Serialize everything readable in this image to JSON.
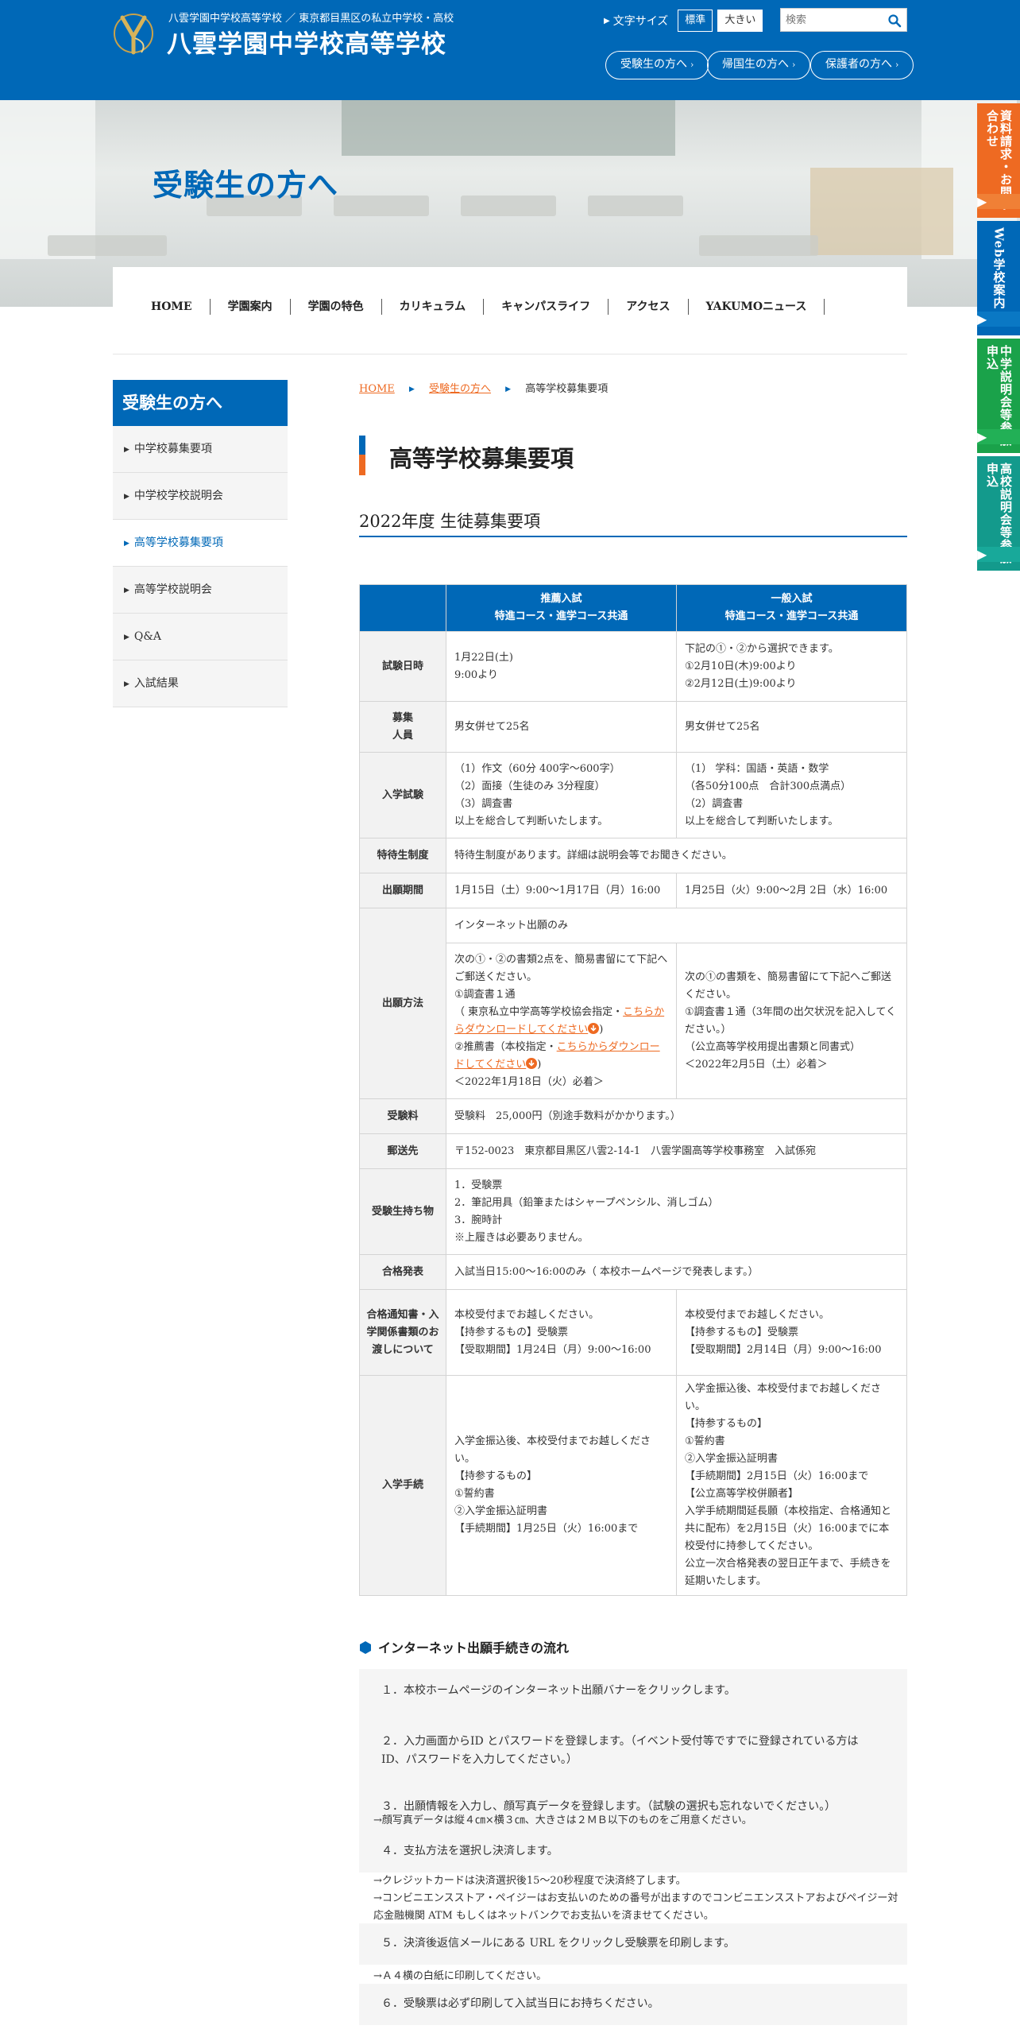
{
  "header": {
    "tagline": "八雲学園中学校高等学校 ／ 東京都目黒区の私立中学校・高校",
    "title": "八雲学園中学校高等学校",
    "font_size_label": "文字サイズ",
    "font_size_normal": "標準",
    "font_size_large": "大きい",
    "search_placeholder": "検索",
    "pills": [
      "受験生の方へ",
      "帰国生の方へ",
      "保護者の方へ"
    ],
    "pill_chev": "›"
  },
  "hero": {
    "title": "受験生の方へ"
  },
  "side_tabs": [
    {
      "label": "資料請求・お問い合わせ",
      "arrow": "▶"
    },
    {
      "label": "Web学校案内",
      "arrow": "▶"
    },
    {
      "label": "中学説明会等参加申込",
      "arrow": "▶"
    },
    {
      "label": "高校説明会等参加申込",
      "arrow": "▶"
    }
  ],
  "gnav": [
    "HOME",
    "学園案内",
    "学園の特色",
    "カリキュラム",
    "キャンパスライフ",
    "アクセス",
    "YAKUMOニュース"
  ],
  "sidebar": {
    "heading": "受験生の方へ",
    "bullet": "▶",
    "items": [
      "中学校募集要項",
      "中学校学校説明会",
      "高等学校募集要項",
      "高等学校説明会",
      "Q&A",
      "入試結果"
    ]
  },
  "breadcrumb": {
    "home": "HOME",
    "parent": "受験生の方へ",
    "current": "高等学校募集要項",
    "sep": "▶"
  },
  "page_title": "高等学校募集要項",
  "section_title": "2022年度 生徒募集要項",
  "table": {
    "col1_head_1": "推薦入試",
    "col1_head_2": "特進コース・進学コース共通",
    "col2_head_1": "一般入試",
    "col2_head_2": "特進コース・進学コース共通",
    "r_date": {
      "label": "試験日時",
      "c1_1": "1月22日(土)",
      "c1_2": "9:00より",
      "c2_1": "下記の①・②から選択できます。",
      "c2_2": "①2月10日(木)9:00より",
      "c2_3": "②2月12日(土)9:00より"
    },
    "r_capacity": {
      "label_1": "募集",
      "label_2": "人員",
      "c1": "男女併せて25名",
      "c2": "男女併せて25名"
    },
    "r_exam": {
      "label": "入学試験",
      "c1_1": "（1）作文（60分 400字〜600字）",
      "c1_2": "（2）面接（生徒のみ 3分程度）",
      "c1_3": "（3）調査書",
      "c1_4": "以上を総合して判断いたします。",
      "c2_1": "（1） 学科：国語・英語・数学",
      "c2_2": "（各50分100点　合計300点満点）",
      "c2_3": "（2）調査書",
      "c2_4": "以上を総合して判断いたします。"
    },
    "r_scholar": {
      "label": "特待生制度",
      "c": "特待生制度があります。詳細は説明会等でお聞きください。"
    },
    "r_period": {
      "label": "出願期間",
      "c1": "1月15日（土）9:00～1月17日（月）16:00",
      "c2": "1月25日（火）9:00～2月 2日（水）16:00"
    },
    "r_method": {
      "label": "出願方法",
      "common": "インターネット出願のみ",
      "c1_1": "次の①・②の書類2点を、簡易書留にて下記へご郵送ください。",
      "c1_2": "①調査書１通",
      "c1_3": "（ 東京私立中学高等学校協会指定・",
      "c1_link1": "こちらからダウンロードしてください",
      "c1_4": ")",
      "c1_5": "②推薦書（本校指定・",
      "c1_link2": "こちらからダウンロードしてください",
      "c1_6": ")",
      "c1_7": "＜2022年1月18日（火）必着＞",
      "c2_1": "次の①の書類を、簡易書留にて下記へご郵送ください。",
      "c2_2": "①調査書１通（3年間の出欠状況を記入してください。）",
      "c2_3": "（公立高等学校用提出書類と同書式）",
      "c2_4": "＜2022年2月5日（土）必着＞"
    },
    "r_fee": {
      "label": "受験料",
      "c": "受験料　25,000円（別途手数料がかかります。）"
    },
    "r_mail": {
      "label": "郵送先",
      "c": "〒152-0023　東京都目黒区八雲2-14-1　八雲学園高等学校事務室　入試係宛"
    },
    "r_items": {
      "label": "受験生持ち物",
      "c1": "1．受験票",
      "c2": "2．筆記用具（鉛筆またはシャープペンシル、消しゴム）",
      "c3": "3．腕時計",
      "c4": "※上履きは必要ありません。"
    },
    "r_result": {
      "label": "合格発表",
      "c": "入試当日15:00～16:00のみ（ 本校ホームページで発表します。）"
    },
    "r_notice": {
      "label": "合格通知書・入学関係書類のお渡しについて",
      "c1_1": "本校受付までお越しください。",
      "c1_2": "【持参するもの】受験票",
      "c1_3": "【受取期間】1月24日（月）9:00～16:00",
      "c2_1": "本校受付までお越しください。",
      "c2_2": "【持参するもの】受験票",
      "c2_3": "【受取期間】2月14日（月）9:00～16:00"
    },
    "r_proc": {
      "label": "入学手続",
      "c1_1": "入学金振込後、本校受付までお越しください。",
      "c1_2": "【持参するもの】",
      "c1_3": "①誓約書",
      "c1_4": "②入学金振込証明書",
      "c1_5": "【手続期間】1月25日（火）16:00まで",
      "c2_1": "入学金振込後、本校受付までお越しください。",
      "c2_2": "【持参するもの】",
      "c2_3": "①誓約書",
      "c2_4": "②入学金振込証明書",
      "c2_5": "【手続期間】2月15日（火）16:00まで",
      "c2_6": "【公立高等学校併願者】",
      "c2_7": "入学手続期間延長願（本校指定、合格通知と共に配布）を2月15日（火）16:00までに本校受付に持参してください。",
      "c2_8": "公立一次合格発表の翌日正午まで、手続きを延期いたします。"
    }
  },
  "flow": {
    "heading": "インターネット出願手続きの流れ",
    "s1": "１．本校ホームページのインターネット出願バナーをクリックします。",
    "s2": "２．入力画面からID とパスワードを登録します。（イベント受付等ですでに登録されている方は ID、パスワードを入力してください。）",
    "s3": "３．出願情報を入力し、顔写真データを登録します。（試験の選択も忘れないでください。）",
    "n3": "→顔写真データは縦４㎝×横３㎝、大きさは２ＭＢ以下のものをご用意ください。",
    "s4": "４．支払方法を選択し決済します。",
    "n4_1": "→クレジットカードは決済選択後15～20秒程度で決済終了します。",
    "n4_2": "→コンビニエンスストア・ペイジーはお支払いのための番号が出ますのでコンビニエンスストアおよびペイジー対応金融機関 ATM もしくはネットバンクでお支払いを済ませてください。",
    "s5": "５．決済後返信メールにある URL をクリックし受験票を印刷します。",
    "n5": "→Ａ４横の白紙に印刷してください。",
    "s6": "６．受験票は必ず印刷して入試当日にお持ちください。"
  },
  "colors": {
    "primary": "#0068b7",
    "accent": "#ee6a22",
    "green": "#1aa24a",
    "teal": "#139a8c"
  }
}
